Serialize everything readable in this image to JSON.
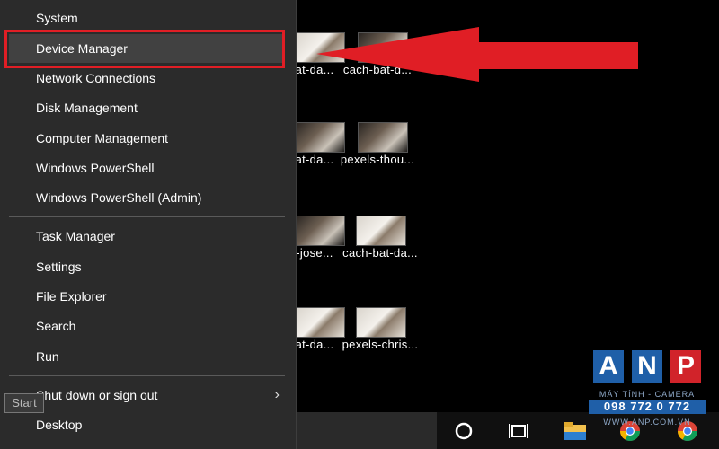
{
  "menu": {
    "items": [
      {
        "label": "System"
      },
      {
        "label": "Device Manager"
      },
      {
        "label": "Network Connections"
      },
      {
        "label": "Disk Management"
      },
      {
        "label": "Computer Management"
      },
      {
        "label": "Windows PowerShell"
      },
      {
        "label": "Windows PowerShell (Admin)"
      },
      {
        "label": "Task Manager"
      },
      {
        "label": "Settings"
      },
      {
        "label": "File Explorer"
      },
      {
        "label": "Search"
      },
      {
        "label": "Run"
      },
      {
        "label": "Shut down or sign out",
        "submenu": true
      },
      {
        "label": "Desktop"
      }
    ],
    "highlighted": "Device Manager",
    "submenu_chevron": "›"
  },
  "start_tooltip": "Start",
  "desktop": {
    "icons": [
      {
        "label": "at-da..."
      },
      {
        "label": "cach-bat-d..."
      },
      {
        "label": "at-da..."
      },
      {
        "label": "pexels-thou..."
      },
      {
        "label": "-jose..."
      },
      {
        "label": "cach-bat-da..."
      },
      {
        "label": "at-da..."
      },
      {
        "label": "pexels-chris..."
      }
    ]
  },
  "taskbar": {
    "icons": [
      "cortana-circle-icon",
      "task-view-icon",
      "file-explorer-icon",
      "chrome-icon",
      "chrome-icon"
    ]
  },
  "watermark": {
    "letters": [
      "A",
      "N",
      "P"
    ],
    "tagline": "MÁY TÍNH - CAMERA",
    "phone": "098 772 0 772",
    "website": "WWW.ANP.COM.VN"
  },
  "colors": {
    "annotation_red": "#e01e25",
    "menu_bg": "#2b2b2b",
    "menu_highlight": "#414141",
    "watermark_blue": "#1f5fa8",
    "watermark_red": "#d1232a"
  }
}
